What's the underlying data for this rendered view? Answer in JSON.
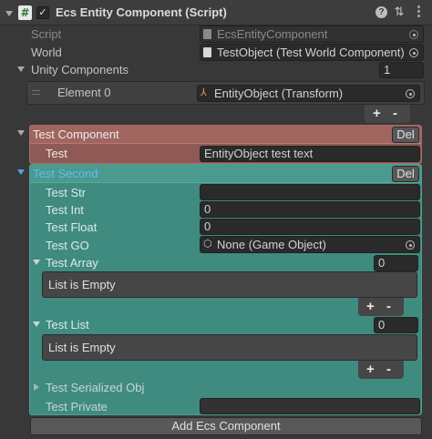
{
  "header": {
    "title": "Ecs Entity Component (Script)",
    "enabled": true
  },
  "script_row": {
    "label": "Script",
    "value": "EcsEntityComponent"
  },
  "world_row": {
    "label": "World",
    "value": "TestObject (Test World Component)"
  },
  "unity_components": {
    "label": "Unity Components",
    "count": "1",
    "elements": [
      {
        "label": "Element 0",
        "value": "EntityObject (Transform)"
      }
    ],
    "add_symbol": "+",
    "remove_symbol": "-"
  },
  "test_component": {
    "title": "Test Component",
    "del_label": "Del",
    "accent_color": "#8f5a55",
    "fields": [
      {
        "label": "Test",
        "value": "EntityObject test text"
      }
    ]
  },
  "test_second": {
    "title": "Test Second",
    "del_label": "Del",
    "accent_color": "#3f8b80",
    "title_color": "#6cb8f4",
    "fields": [
      {
        "label": "Test Str",
        "value": ""
      },
      {
        "label": "Test Int",
        "value": "0"
      },
      {
        "label": "Test Float",
        "value": "0"
      },
      {
        "label": "Test GO",
        "value": "None (Game Object)"
      }
    ],
    "test_array": {
      "label": "Test Array",
      "count": "0",
      "empty_text": "List is Empty",
      "add_symbol": "+",
      "remove_symbol": "-"
    },
    "test_list": {
      "label": "Test List",
      "count": "0",
      "empty_text": "List is Empty",
      "add_symbol": "+",
      "remove_symbol": "-"
    },
    "serialized_obj": {
      "label": "Test Serialized Obj"
    },
    "private_field": {
      "label": "Test Private",
      "value": ""
    }
  },
  "add_component_label": "Add Ecs Component"
}
